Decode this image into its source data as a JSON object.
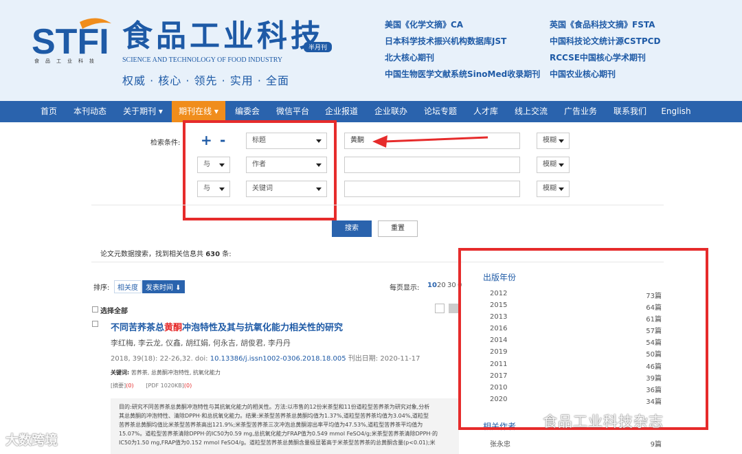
{
  "header": {
    "logo_text": "STFI",
    "logo_sub": "食品工业科技",
    "cn_title": "食品工业科技",
    "badge": "半月刊",
    "en_title": "SCIENCE AND TECHNOLOGY OF FOOD INDUSTRY",
    "slogan": "权威 · 核心 · 领先 · 实用 · 全面",
    "index_left": [
      "美国《化学文摘》CA",
      "日本科学技术振兴机构数据库JST",
      "北大核心期刊",
      "中国生物医学文献系统SinoMed收录期刊"
    ],
    "index_right": [
      "英国《食品科技文摘》FSTA",
      "中国科技论文统计源CSTPCD",
      "RCCSE中国核心学术期刊",
      "中国农业核心期刊"
    ]
  },
  "nav": {
    "items": [
      {
        "label": "首页"
      },
      {
        "label": "本刊动态"
      },
      {
        "label": "关于期刊 ▾"
      },
      {
        "label": "期刊在线 ▾"
      },
      {
        "label": "编委会"
      },
      {
        "label": "微信平台"
      },
      {
        "label": "企业报道"
      },
      {
        "label": "企业联办"
      },
      {
        "label": "论坛专题"
      },
      {
        "label": "人才库"
      },
      {
        "label": "线上交流"
      },
      {
        "label": "广告业务"
      },
      {
        "label": "联系我们"
      },
      {
        "label": "English"
      }
    ],
    "active_index": 3
  },
  "search": {
    "condition_label": "检索条件:",
    "plus": "+",
    "minus": "-",
    "rows": [
      {
        "logic": "",
        "field": "标题",
        "value": "黄酮",
        "match": "模糊"
      },
      {
        "logic": "与",
        "field": "作者",
        "value": "",
        "match": "模糊"
      },
      {
        "logic": "与",
        "field": "关键词",
        "value": "",
        "match": "模糊"
      }
    ],
    "search_button": "搜索",
    "reset_button": "重置"
  },
  "results": {
    "summary_prefix": "论文元数据搜索，找到相关信息共",
    "count": "630",
    "summary_suffix": "条:",
    "sort_label": "排序:",
    "sort_relevance": "相关度",
    "sort_time": "发表时间 ⬇",
    "perpage_label": "每页显示:",
    "perpage_options": [
      "10",
      "20",
      "30",
      "0"
    ],
    "select_all": "选择全部",
    "article": {
      "title_before": "不同苦荞茶总",
      "title_highlight": "黄酮",
      "title_after": "冲泡特性及其与抗氧化能力相关性的研究",
      "authors": "李红梅, 李云龙, 仪鑫, 胡红娟, 何永吉, 胡俊君, 李丹丹",
      "cite_prefix": "2018, 39(18): 22-26,32. doi:",
      "doi": "10.13386/j.issn1002-0306.2018.18.005",
      "pub_date": "刊出日期: 2020-11-17",
      "keywords_label": "关键词:",
      "keywords": "苦荞茶, 总黄酮冲泡特性, 抗氧化能力",
      "abstract_link": "[摘要]",
      "abstract_count": "(0)",
      "pdf_link": "[PDF 1020KB]",
      "pdf_count": "(0)",
      "abstract_lines": [
        "目的:研究不同苦荞茶总黄酮冲泡特性与其抗氧化能力的相关性。方法:以市售的12份米茶型和11份道粒型苦荞茶为研究对象,分析",
        "其总黄酮的冲泡特性、清除DPPH·和总抗氧化能力。结果:米茶型苦荞茶总黄酮均值为1.37%,道粒型苦荞茶均值为3.04%,道粒型",
        "苦荞茶总黄酮均值比米茶型苦荞茶高出121.9%;米茶型苦荞茶三次冲泡总黄酮溶出率平均值为47.53%,道粒型苦荞茶平均值为",
        "15.07%。道粒型苦荞茶清除DPPH·的IC50为0.59 mg,总抗氧化能力FRAP值为0.549 mmol FeSO4/g;米茶型苦荞茶清除DPPH·的",
        "IC50为1.50 mg,FRAP值为0.152 mmol FeSO4/g。道粒型苦荞茶总黄酮含量极显著高于米茶型苦荞茶的总黄酮含量(p<0.01);米"
      ]
    }
  },
  "facets": {
    "year_title": "出版年份",
    "years": [
      {
        "year": "2012",
        "count": "73篇"
      },
      {
        "year": "2015",
        "count": "64篇"
      },
      {
        "year": "2013",
        "count": "61篇"
      },
      {
        "year": "2016",
        "count": "57篇"
      },
      {
        "year": "2014",
        "count": "54篇"
      },
      {
        "year": "2019",
        "count": "50篇"
      },
      {
        "year": "2011",
        "count": "46篇"
      },
      {
        "year": "2017",
        "count": "39篇"
      },
      {
        "year": "2010",
        "count": "36篇"
      },
      {
        "year": "2020",
        "count": "34篇"
      }
    ],
    "author_title": "相关作者",
    "authors": [
      {
        "name": "张永忠",
        "count": "9篇"
      }
    ]
  },
  "watermarks": {
    "left": "大数跨境",
    "right": "食品工业科技杂志"
  },
  "colors": {
    "brand_blue": "#1e5aa6",
    "nav_blue": "#2a63ad",
    "nav_active": "#f08d1c",
    "highlight_red": "#e62b2b",
    "header_bg": "#e8f1fa"
  }
}
